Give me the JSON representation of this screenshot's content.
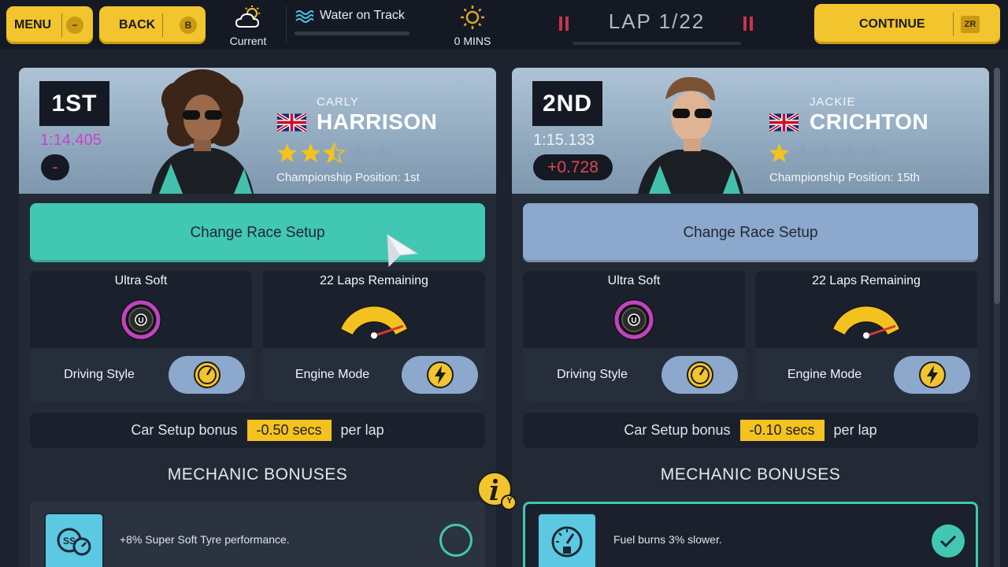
{
  "topbar": {
    "menu_label": "MENU",
    "menu_badge": "−",
    "back_label": "BACK",
    "back_badge": "B",
    "weather_label": "Current",
    "weather_icon": "cloud-sun-icon",
    "water_label": "Water on Track",
    "water_icon": "water-waves-icon",
    "sun_label": "0 MINS",
    "sun_icon": "sun-icon",
    "lap_label": "LAP 1/22",
    "continue_label": "CONTINUE",
    "continue_badge": "ZR"
  },
  "drivers": [
    {
      "position": "1ST",
      "lap_time": "1:14.405",
      "lap_time_color": "#c444c9",
      "gap": "-",
      "first_name": "CARLY",
      "last_name": "HARRISON",
      "stars": 2.5,
      "championship": "Championship Position: 1st",
      "setup_label": "Change Race Setup",
      "tyre_label": "Ultra Soft",
      "tyre_letter": "U",
      "laps_label": "22 Laps Remaining",
      "driving_style_label": "Driving Style",
      "engine_mode_label": "Engine Mode",
      "bonus_label": "Car Setup bonus",
      "bonus_value": "-0.50 secs",
      "bonus_suffix": "per lap",
      "mech_title": "MECHANIC BONUSES",
      "mech_text": "+8% Super Soft Tyre performance.",
      "mech_icon": "tyre-speed-icon",
      "mech_selected": false
    },
    {
      "position": "2ND",
      "lap_time": "1:15.133",
      "lap_time_color": "#e9eef5",
      "gap": "+0.728",
      "first_name": "JACKIE",
      "last_name": "CRICHTON",
      "stars": 1,
      "championship": "Championship Position: 15th",
      "setup_label": "Change Race Setup",
      "tyre_label": "Ultra Soft",
      "tyre_letter": "U",
      "laps_label": "22 Laps Remaining",
      "driving_style_label": "Driving Style",
      "engine_mode_label": "Engine Mode",
      "bonus_label": "Car Setup bonus",
      "bonus_value": "-0.10 secs",
      "bonus_suffix": "per lap",
      "mech_title": "MECHANIC BONUSES",
      "mech_text": "Fuel burns 3% slower.",
      "mech_icon": "fuel-gauge-icon",
      "mech_selected": true
    }
  ],
  "info_badge": "Y",
  "colors": {
    "accent_yellow": "#f2c42e",
    "teal": "#41c7b2",
    "slate_blue": "#8ca8cc",
    "gap_red": "#e0464f"
  }
}
